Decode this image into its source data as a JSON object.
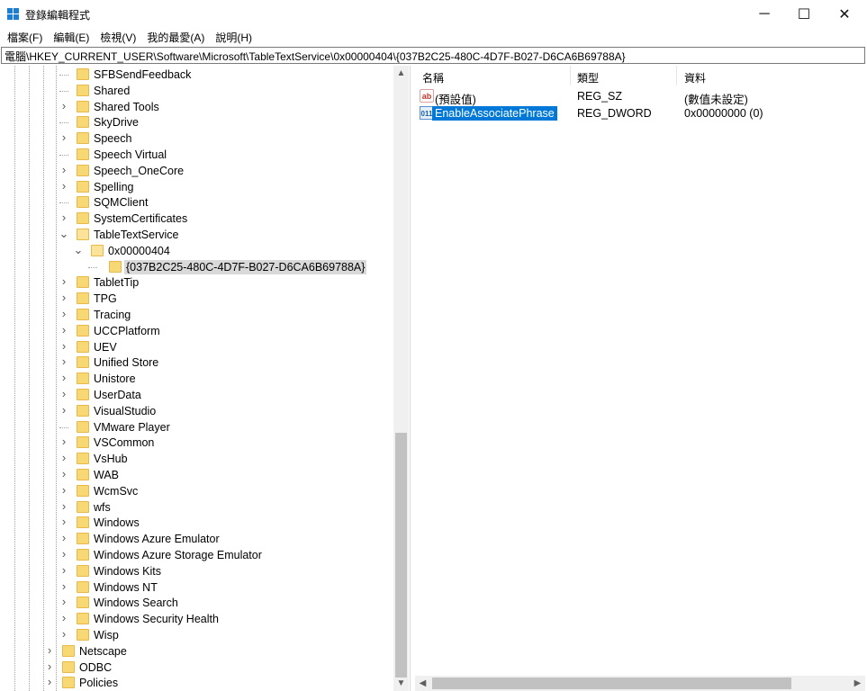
{
  "window": {
    "title": "登錄編輯程式",
    "minimize_glyph": "─",
    "maximize_glyph": "☐",
    "close_glyph": "✕"
  },
  "menu": [
    "檔案(F)",
    "編輯(E)",
    "檢視(V)",
    "我的最愛(A)",
    "說明(H)"
  ],
  "address": "電腦\\HKEY_CURRENT_USER\\Software\\Microsoft\\TableTextService\\0x00000404\\{037B2C25-480C-4D7F-B027-D6CA6B69788A}",
  "tree": [
    {
      "label": "SFBSendFeedback",
      "level": 2,
      "expander": "none"
    },
    {
      "label": "Shared",
      "level": 2,
      "expander": "none"
    },
    {
      "label": "Shared Tools",
      "level": 2,
      "expander": "collapsed"
    },
    {
      "label": "SkyDrive",
      "level": 2,
      "expander": "none"
    },
    {
      "label": "Speech",
      "level": 2,
      "expander": "collapsed"
    },
    {
      "label": "Speech Virtual",
      "level": 2,
      "expander": "none"
    },
    {
      "label": "Speech_OneCore",
      "level": 2,
      "expander": "collapsed"
    },
    {
      "label": "Spelling",
      "level": 2,
      "expander": "collapsed"
    },
    {
      "label": "SQMClient",
      "level": 2,
      "expander": "none"
    },
    {
      "label": "SystemCertificates",
      "level": 2,
      "expander": "collapsed"
    },
    {
      "label": "TableTextService",
      "level": 2,
      "expander": "expanded"
    },
    {
      "label": "0x00000404",
      "level": 3,
      "expander": "expanded"
    },
    {
      "label": "{037B2C25-480C-4D7F-B027-D6CA6B69788A}",
      "level": 4,
      "expander": "none",
      "selected": true
    },
    {
      "label": "TabletTip",
      "level": 2,
      "expander": "collapsed"
    },
    {
      "label": "TPG",
      "level": 2,
      "expander": "collapsed"
    },
    {
      "label": "Tracing",
      "level": 2,
      "expander": "collapsed"
    },
    {
      "label": "UCCPlatform",
      "level": 2,
      "expander": "collapsed"
    },
    {
      "label": "UEV",
      "level": 2,
      "expander": "collapsed"
    },
    {
      "label": "Unified Store",
      "level": 2,
      "expander": "collapsed"
    },
    {
      "label": "Unistore",
      "level": 2,
      "expander": "collapsed"
    },
    {
      "label": "UserData",
      "level": 2,
      "expander": "collapsed"
    },
    {
      "label": "VisualStudio",
      "level": 2,
      "expander": "collapsed"
    },
    {
      "label": "VMware Player",
      "level": 2,
      "expander": "none"
    },
    {
      "label": "VSCommon",
      "level": 2,
      "expander": "collapsed"
    },
    {
      "label": "VsHub",
      "level": 2,
      "expander": "collapsed"
    },
    {
      "label": "WAB",
      "level": 2,
      "expander": "collapsed"
    },
    {
      "label": "WcmSvc",
      "level": 2,
      "expander": "collapsed"
    },
    {
      "label": "wfs",
      "level": 2,
      "expander": "collapsed"
    },
    {
      "label": "Windows",
      "level": 2,
      "expander": "collapsed"
    },
    {
      "label": "Windows Azure Emulator",
      "level": 2,
      "expander": "collapsed"
    },
    {
      "label": "Windows Azure Storage Emulator",
      "level": 2,
      "expander": "collapsed"
    },
    {
      "label": "Windows Kits",
      "level": 2,
      "expander": "collapsed"
    },
    {
      "label": "Windows NT",
      "level": 2,
      "expander": "collapsed"
    },
    {
      "label": "Windows Search",
      "level": 2,
      "expander": "collapsed"
    },
    {
      "label": "Windows Security Health",
      "level": 2,
      "expander": "collapsed"
    },
    {
      "label": "Wisp",
      "level": 2,
      "expander": "collapsed"
    },
    {
      "label": "Netscape",
      "level": 1,
      "expander": "collapsed"
    },
    {
      "label": "ODBC",
      "level": 1,
      "expander": "collapsed"
    },
    {
      "label": "Policies",
      "level": 1,
      "expander": "collapsed"
    }
  ],
  "list": {
    "headers": {
      "name": "名稱",
      "type": "類型",
      "data": "資料"
    },
    "rows": [
      {
        "icon": "string-value-icon",
        "icon_text": "ab",
        "name": "(預設值)",
        "type": "REG_SZ",
        "data": "(數值未設定)",
        "selected": false
      },
      {
        "icon": "dword-value-icon",
        "icon_text": "011",
        "name": "EnableAssociatePhrase",
        "type": "REG_DWORD",
        "data": "0x00000000 (0)",
        "selected": true
      }
    ]
  },
  "colors": {
    "selection_blue": "#0078d7",
    "tree_selection_gray": "#d9d9d9",
    "folder_yellow": "#f8d775"
  }
}
